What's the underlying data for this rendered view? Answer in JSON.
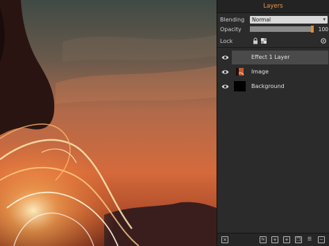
{
  "panel": {
    "title": "Layers",
    "blending_label": "Blending",
    "blending_value": "Normal",
    "opacity_label": "Opacity",
    "opacity_value": "100",
    "opacity_fraction": 1.0,
    "lock_label": "Lock",
    "accent_color": "#f19a3e"
  },
  "layers": [
    {
      "name": "Effect 1 Layer",
      "visible": true,
      "selected": true,
      "thumb": "none"
    },
    {
      "name": "Image",
      "visible": true,
      "selected": false,
      "thumb": "image"
    },
    {
      "name": "Background",
      "visible": true,
      "selected": false,
      "thumb": "black"
    }
  ],
  "toolbar": {
    "icons": [
      "close-icon",
      "fx-icon",
      "add-layer-icon",
      "add-icon",
      "duplicate-icon",
      "merge-icon",
      "delete-icon"
    ]
  }
}
